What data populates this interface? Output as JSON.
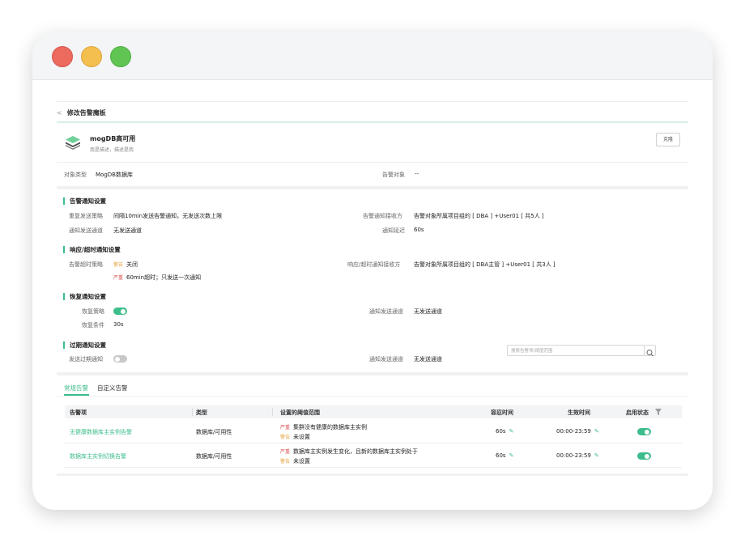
{
  "window": {
    "controls": [
      "close",
      "minimize",
      "maximize"
    ]
  },
  "header": {
    "back_label": "修改告警魔板"
  },
  "template": {
    "name": "mogDB高可用",
    "desc": "我是描述，描述是我",
    "clone_label": "克隆",
    "object_type_label": "对象类型",
    "object_type_value": "MogDB数据库",
    "alert_object_label": "告警对象",
    "alert_object_value": "--"
  },
  "alert_notify": {
    "title": "告警通知设置",
    "repeat_label": "重复发送策略",
    "repeat_value": "间隔10min发送告警通知，无发送次数上限",
    "receiver_label": "告警通知接收方",
    "receiver_value": "告警对象所属项目组的 [ DBA ] +User01 [ 共5人 ]",
    "channel_label": "通知发送通道",
    "channel_value": "无发送通道",
    "delay_label": "通知延迟",
    "delay_value": "60s"
  },
  "timeout_notify": {
    "title": "响应/超时通知设置",
    "policy_label": "告警超时策略",
    "warn_tag": "警告",
    "warn_value": "关闭",
    "severe_tag": "严重",
    "severe_value": "60min超时；只发送一次通知",
    "receiver_label": "响应/超时通知接收方",
    "receiver_value": "告警对象所属项目组的 [ DBA主管 ] +User01 [ 共3人 ]"
  },
  "recover_notify": {
    "title": "恢复通知设置",
    "policy_label": "恢复策略",
    "policy_on": true,
    "condition_label": "恢复条件",
    "condition_value": "30s",
    "channel_label": "通知发送通道",
    "channel_value": "无发送通道"
  },
  "expire_notify": {
    "title": "过期通知设置",
    "send_label": "发送过期通知",
    "send_on": false,
    "channel_label": "通知发送通道",
    "channel_value": "无发送通道"
  },
  "tabs": [
    {
      "label": "常规告警",
      "active": true
    },
    {
      "label": "自定义告警",
      "active": false
    }
  ],
  "search": {
    "placeholder": "搜索告警项/阈值范围"
  },
  "table": {
    "columns": [
      "告警项",
      "类型",
      "设置的阈值范围",
      "容忍时间",
      "生效时间",
      "启用状态"
    ],
    "rows": [
      {
        "item": "无健康数据库主实例告警",
        "type": "数据库/可用性",
        "severe_tag": "严重",
        "severe_value": "集群没有健康的数据库主实例",
        "warn_tag": "警告",
        "warn_value": "未设置",
        "tolerance": "60s",
        "effective": "00:00-23:59",
        "enabled": true
      },
      {
        "item": "数据库主实例切换告警",
        "type": "数据库/可用性",
        "severe_tag": "严重",
        "severe_value": "数据库主实例发生变化，且新的数据库主实例处于",
        "warn_tag": "警告",
        "warn_value": "未设置",
        "tolerance": "60s",
        "effective": "00:00-23:59",
        "enabled": true
      }
    ]
  },
  "colors": {
    "accent": "#3dbd8a",
    "warn": "#e6a23c",
    "severe": "#e05050"
  }
}
